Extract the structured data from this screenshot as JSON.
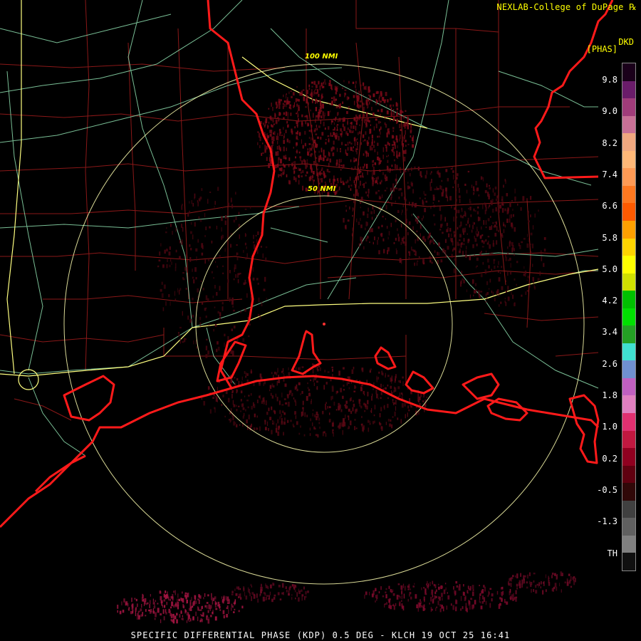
{
  "header": {
    "credit": "NEXLAB-College of DuPage",
    "product_code": "DKD",
    "units": "[PHAS]"
  },
  "footer": {
    "caption": "SPECIFIC DIFFERENTIAL PHASE (KDP) 0.5 DEG - KLCH 19 OCT 25 16:41"
  },
  "range_rings": [
    {
      "label": "50 NMI"
    },
    {
      "label": "100 NMI"
    }
  ],
  "colorbar": {
    "ticks": [
      "9.8",
      "9.0",
      "8.2",
      "7.4",
      "6.6",
      "5.8",
      "5.0",
      "4.2",
      "3.4",
      "2.6",
      "1.8",
      "1.0",
      "0.2",
      "-0.5",
      "-1.3",
      "TH"
    ],
    "colors": [
      "#1a001a",
      "#6a1c6a",
      "#a03c7a",
      "#c87096",
      "#f0a880",
      "#ffb878",
      "#ff9a55",
      "#ff7820",
      "#ff5a00",
      "#ffa000",
      "#ffd400",
      "#ffff00",
      "#d0e000",
      "#00c000",
      "#00e000",
      "#24a024",
      "#40e0d0",
      "#7090d0",
      "#c060c0",
      "#e080c0",
      "#e03070",
      "#c01840",
      "#900020",
      "#600010",
      "#300808",
      "#404040",
      "#606060",
      "#808080",
      "#101010"
    ]
  },
  "colors": {
    "coastline": "#ff1a1a",
    "county_lines": "#9a1a1a",
    "highways": "#90e0b0",
    "interstates": "#ffff80",
    "range_rings": "#ffffb0",
    "echo": "#8a0a1a"
  }
}
